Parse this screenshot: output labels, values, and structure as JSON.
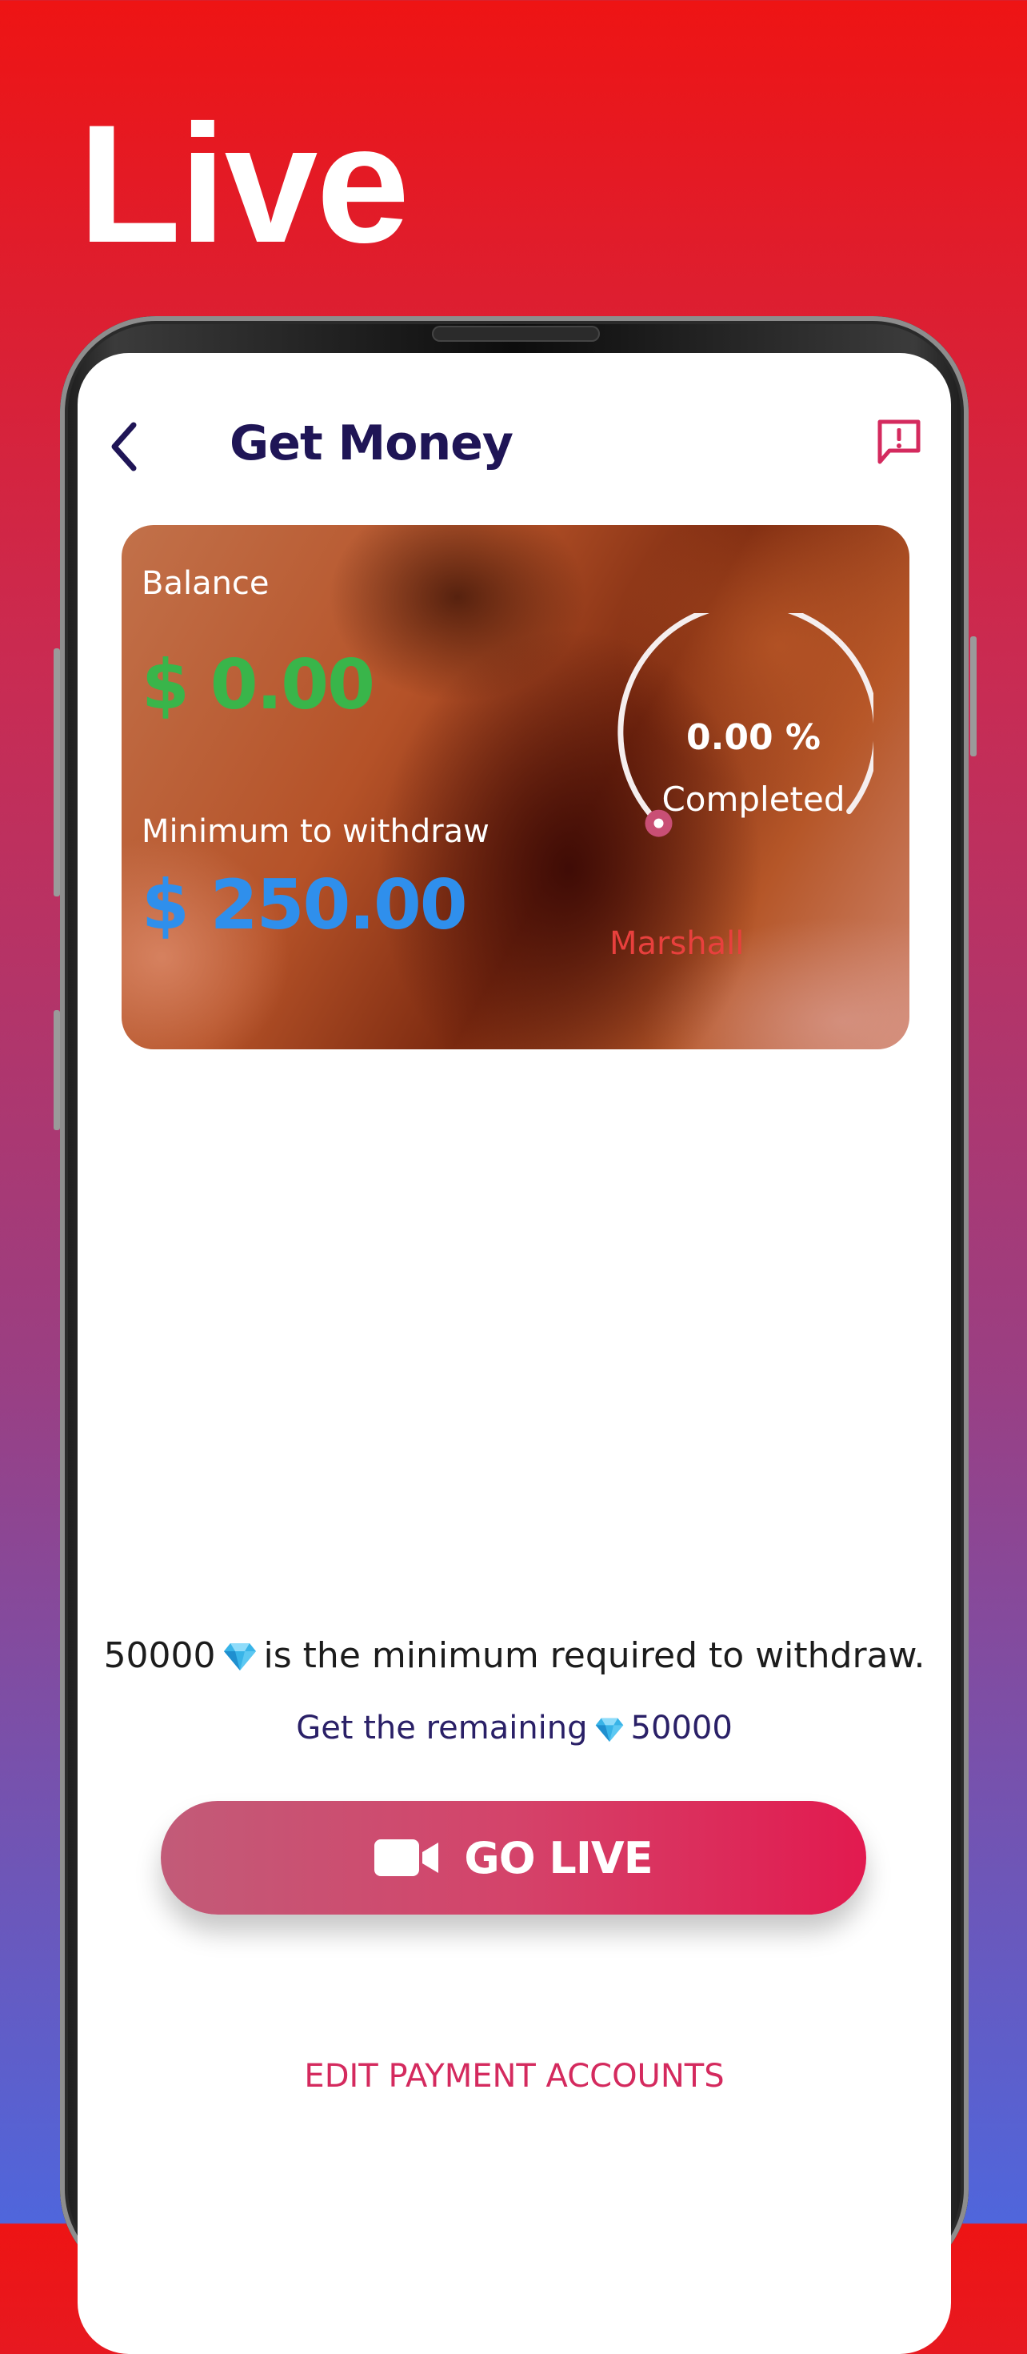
{
  "hero": {
    "title": "Live"
  },
  "header": {
    "title": "Get Money"
  },
  "card": {
    "balance_label": "Balance",
    "balance_value": "$ 0.00",
    "minimum_label": "Minimum to withdraw",
    "minimum_value": "$ 250.00",
    "progress_text": "0.00 %",
    "progress_caption": "Completed",
    "progress_fraction": 0.0,
    "holder_name": "Marshall"
  },
  "info": {
    "min_required_amount": "50000",
    "min_required_text": "is the minimum required to withdraw.",
    "remaining_prefix": "Get the remaining",
    "remaining_amount": "50000"
  },
  "actions": {
    "go_live_label": "GO LIVE",
    "edit_accounts_label": "EDIT PAYMENT ACCOUNTS"
  },
  "icons": {
    "back": "chevron-left-icon",
    "report": "report-icon",
    "gem": "diamond-icon",
    "video": "video-camera-icon"
  },
  "colors": {
    "balance": "#39b54a",
    "minimum": "#2f8fec",
    "accent": "#e21a4f",
    "title": "#1f1556",
    "holder": "#e8403d"
  }
}
